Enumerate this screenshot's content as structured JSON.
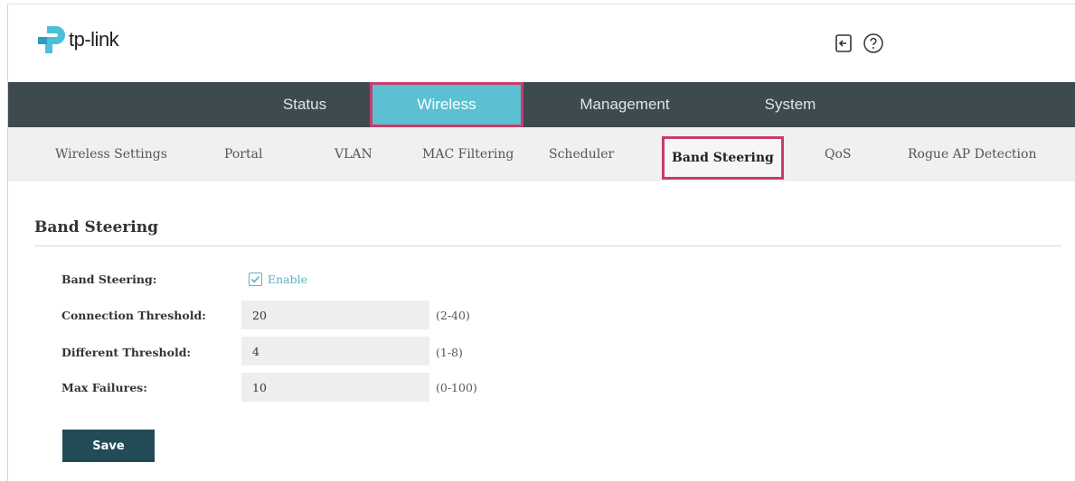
{
  "header": {
    "brand": "tp-link",
    "logout_icon": "logout-icon",
    "help_icon": "help-icon",
    "colors": {
      "logo_primary": "#4ac1d8",
      "logo_secondary": "#2d9dc0"
    }
  },
  "main_nav": {
    "items": [
      {
        "label": "Status",
        "active": false
      },
      {
        "label": "Wireless",
        "active": true
      },
      {
        "label": "Management",
        "active": false
      },
      {
        "label": "System",
        "active": false
      }
    ],
    "colors": {
      "background": "#3d4a50",
      "active": "#5cc0d3",
      "highlight_border": "#c73d6d"
    }
  },
  "sub_nav": {
    "items": [
      {
        "label": "Wireless Settings",
        "active": false
      },
      {
        "label": "Portal",
        "active": false
      },
      {
        "label": "VLAN",
        "active": false
      },
      {
        "label": "MAC Filtering",
        "active": false
      },
      {
        "label": "Scheduler",
        "active": false
      },
      {
        "label": "Band Steering",
        "active": true
      },
      {
        "label": "QoS",
        "active": false
      },
      {
        "label": "Rogue AP Detection",
        "active": false
      }
    ]
  },
  "content": {
    "section_title": "Band Steering",
    "fields": {
      "band_steering": {
        "label": "Band Steering:",
        "checkbox_label": "Enable",
        "checked": true
      },
      "connection_threshold": {
        "label": "Connection Threshold:",
        "value": "20",
        "range": "(2-40)"
      },
      "different_threshold": {
        "label": "Different Threshold:",
        "value": "4",
        "range": "(1-8)"
      },
      "max_failures": {
        "label": "Max Failures:",
        "value": "10",
        "range": "(0-100)"
      }
    },
    "save_label": "Save",
    "colors": {
      "save_button": "#234b57",
      "checkbox_accent": "#5cb0c6"
    }
  }
}
